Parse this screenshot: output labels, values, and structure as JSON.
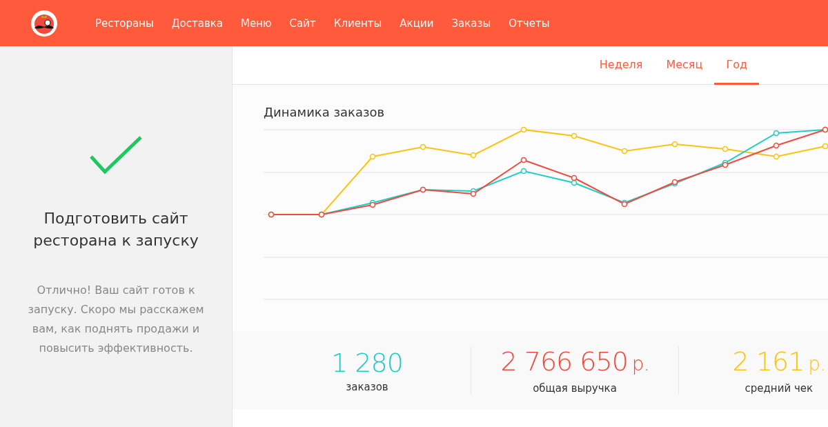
{
  "nav": {
    "items": [
      {
        "label": "Рестораны"
      },
      {
        "label": "Доставка"
      },
      {
        "label": "Меню"
      },
      {
        "label": "Сайт"
      },
      {
        "label": "Клиенты"
      },
      {
        "label": "Акции"
      },
      {
        "label": "Заказы"
      },
      {
        "label": "Отчеты"
      }
    ]
  },
  "sidebar": {
    "title": "Подготовить сайт ресторана к запуску",
    "text": "Отлично! Ваш сайт готов к запуску. Скоро мы расскажем вам, как поднять продажи и повысить эффективность."
  },
  "period_tabs": [
    {
      "label": "Неделя",
      "selected": false
    },
    {
      "label": "Месяц",
      "selected": false
    },
    {
      "label": "Год",
      "selected": true
    }
  ],
  "chart": {
    "title": "Динамика заказов"
  },
  "stats": [
    {
      "value": "1 280",
      "label": "заказов",
      "color": "#1ecdc4"
    },
    {
      "value": "2 766 650",
      "unit": "р.",
      "label": "общая выручка",
      "color": "#f04a3e"
    },
    {
      "value": "2 161",
      "unit": "р.",
      "label": "средний чек",
      "color": "#ffc20e"
    }
  ]
}
